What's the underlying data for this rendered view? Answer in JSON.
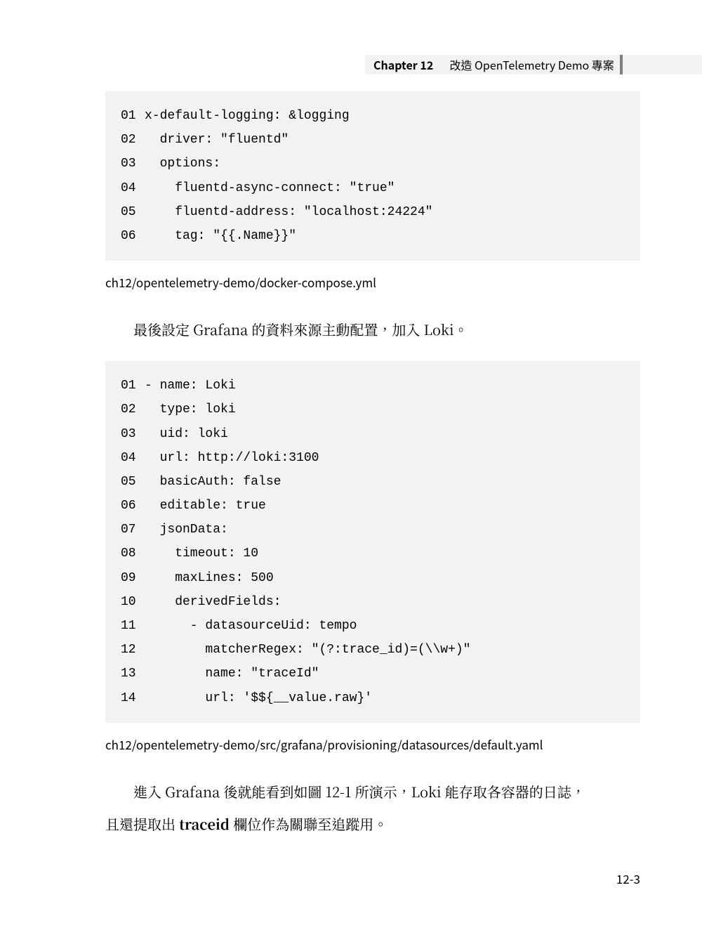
{
  "header": {
    "chapter": "Chapter 12",
    "title": "改造 OpenTelemetry Demo 專案"
  },
  "code_block_1": {
    "lines": [
      {
        "num": "01",
        "text": "x-default-logging: &logging"
      },
      {
        "num": "02",
        "text": "  driver: \"fluentd\""
      },
      {
        "num": "03",
        "text": "  options:"
      },
      {
        "num": "04",
        "text": "    fluentd-async-connect: \"true\""
      },
      {
        "num": "05",
        "text": "    fluentd-address: \"localhost:24224\""
      },
      {
        "num": "06",
        "text": "    tag: \"{{.Name}}\""
      }
    ]
  },
  "caption_1": "ch12/opentelemetry-demo/docker-compose.yml",
  "paragraph_1": "最後設定 Grafana 的資料來源主動配置，加入 Loki。",
  "code_block_2": {
    "lines": [
      {
        "num": "01",
        "text": "- name: Loki"
      },
      {
        "num": "02",
        "text": "  type: loki"
      },
      {
        "num": "03",
        "text": "  uid: loki"
      },
      {
        "num": "04",
        "text": "  url: http://loki:3100"
      },
      {
        "num": "05",
        "text": "  basicAuth: false"
      },
      {
        "num": "06",
        "text": "  editable: true"
      },
      {
        "num": "07",
        "text": "  jsonData:"
      },
      {
        "num": "08",
        "text": "    timeout: 10"
      },
      {
        "num": "09",
        "text": "    maxLines: 500"
      },
      {
        "num": "10",
        "text": "    derivedFields:"
      },
      {
        "num": "11",
        "text": "      - datasourceUid: tempo"
      },
      {
        "num": "12",
        "text": "        matcherRegex: \"(?:trace_id)=(\\\\w+)\""
      },
      {
        "num": "13",
        "text": "        name: \"traceId\""
      },
      {
        "num": "14",
        "text": "        url: '$${__value.raw}'"
      }
    ]
  },
  "caption_2": "ch12/opentelemetry-demo/src/grafana/provisioning/datasources/default.yaml",
  "paragraph_2_line1": "進入 Grafana 後就能看到如圖 12-1 所演示，Loki 能存取各容器的日誌，",
  "paragraph_2_line2_prefix": "且還提取出 ",
  "paragraph_2_bold": "traceid",
  "paragraph_2_line2_suffix": " 欄位作為關聯至追蹤用。",
  "page_number": "12-3"
}
